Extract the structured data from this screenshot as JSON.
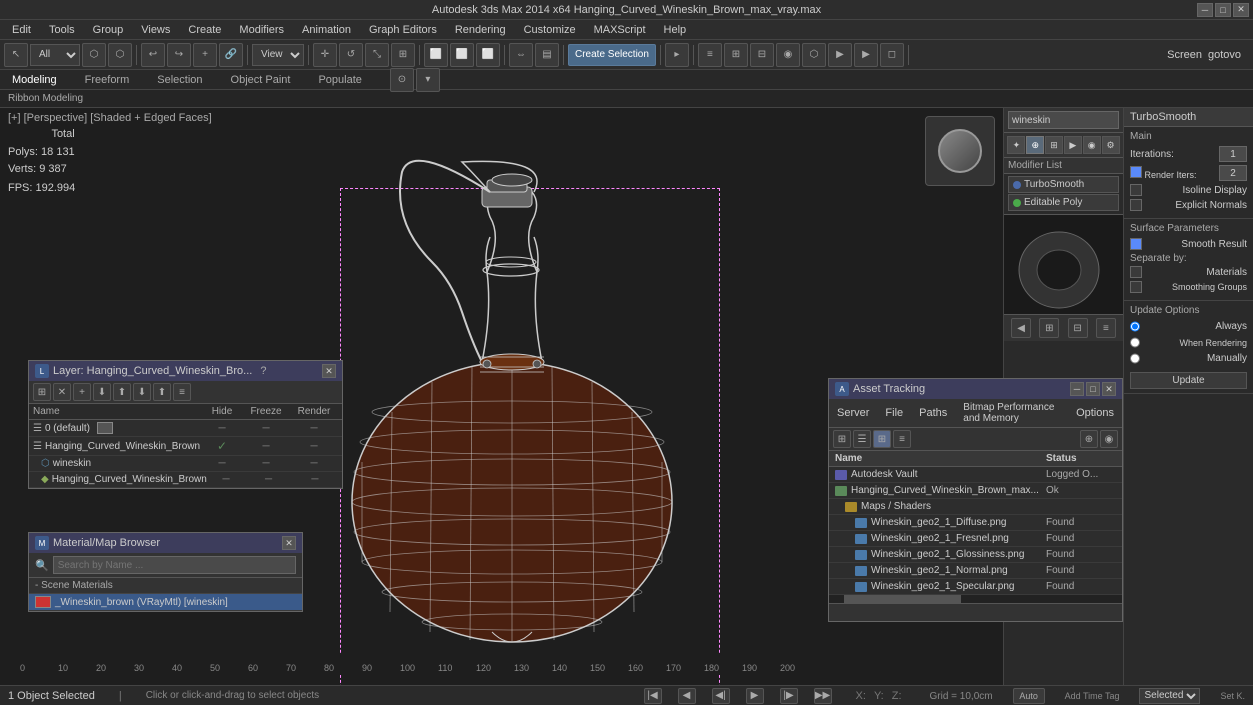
{
  "titleBar": {
    "title": "Autodesk 3ds Max 2014 x64    Hanging_Curved_Wineskin_Brown_max_vray.max",
    "minimize": "─",
    "maximize": "□",
    "close": "✕"
  },
  "menuBar": {
    "items": [
      "Edit",
      "Tools",
      "Group",
      "Views",
      "Create",
      "Modifiers",
      "Animation",
      "Graph Editors",
      "Rendering",
      "Customize",
      "MAXScript",
      "Help"
    ]
  },
  "toolbar": {
    "viewDropdown": "All",
    "viewTypeDropdown": "View",
    "createSelection": "Create Selection"
  },
  "modeBars": {
    "top": [
      "Modeling",
      "Freeform",
      "Selection",
      "Object Paint",
      "Populate"
    ],
    "bottom": "Ribbon Modeling"
  },
  "viewport": {
    "label": "[+] [Perspective] [Shaded + Edged Faces]",
    "stats": {
      "totalLabel": "Total",
      "polysLabel": "Polys:",
      "polysValue": "18 131",
      "vertsLabel": "Verts:",
      "vertsValue": "9 387",
      "fpsLabel": "FPS:",
      "fpsValue": "192.994"
    }
  },
  "rightPanel": {
    "objectName": "wineskin",
    "modifierListLabel": "Modifier List",
    "modifiers": [
      {
        "name": "TurboSmooth",
        "active": true
      },
      {
        "name": "Editable Poly",
        "active": true
      }
    ]
  },
  "turbosmooth": {
    "title": "TurboSmooth",
    "mainLabel": "Main",
    "iterations": {
      "label": "Iterations:",
      "value": "1"
    },
    "renderIters": {
      "label": "Render Iters:",
      "value": "2"
    },
    "isoline": {
      "label": "Isoline Display"
    },
    "explicitNormals": {
      "label": "Explicit Normals"
    },
    "surfaceParams": {
      "title": "Surface Parameters"
    },
    "smoothResult": {
      "label": "Smooth Result"
    },
    "separateBy": {
      "label": "Separate by:"
    },
    "materials": {
      "label": "Materials"
    },
    "smoothingGroups": {
      "label": "Smoothing Groups"
    },
    "updateOptions": {
      "title": "Update Options"
    },
    "always": {
      "label": "Always"
    },
    "whenRendering": {
      "label": "When Rendering"
    },
    "manually": {
      "label": "Manually"
    },
    "updateBtn": "Update"
  },
  "layerDialog": {
    "title": "Layer: Hanging_Curved_Wineskin_Bro...",
    "questionMark": "?",
    "columns": {
      "name": "Name",
      "hide": "Hide",
      "freeze": "Freeze",
      "render": "Render"
    },
    "layers": [
      {
        "indent": 0,
        "name": "0 (default)",
        "hide": "─",
        "freeze": "─",
        "render": "─",
        "isDefault": true
      },
      {
        "indent": 0,
        "name": "Hanging_Curved_Wineskin_Brown",
        "hide": "─",
        "freeze": "─",
        "render": "─",
        "hasCheck": true
      },
      {
        "indent": 1,
        "name": "wineskin",
        "hide": "─",
        "freeze": "─",
        "render": "─"
      },
      {
        "indent": 1,
        "name": "Hanging_Curved_Wineskin_Brown",
        "hide": "─",
        "freeze": "─",
        "render": "─"
      }
    ]
  },
  "materialBrowser": {
    "title": "Material/Map Browser",
    "searchPlaceholder": "Search by Name ...",
    "sceneMaterialsLabel": "- Scene Materials",
    "materials": [
      {
        "name": "_Wineskin_brown (VRayMtl) [wineskin]",
        "selected": true
      }
    ]
  },
  "assetTracking": {
    "title": "Asset Tracking",
    "windowControls": [
      "─",
      "□",
      "✕"
    ],
    "menu": [
      "Server",
      "File",
      "Paths",
      "Bitmap Performance and Memory",
      "Options"
    ],
    "columns": {
      "name": "Name",
      "status": "Status"
    },
    "rows": [
      {
        "indent": 0,
        "name": "Autodesk Vault",
        "status": "Logged O...",
        "iconType": "vault"
      },
      {
        "indent": 0,
        "name": "Hanging_Curved_Wineskin_Brown_max...",
        "status": "Ok",
        "iconType": "file"
      },
      {
        "indent": 1,
        "name": "Maps / Shaders",
        "status": "",
        "iconType": "folder"
      },
      {
        "indent": 2,
        "name": "Wineskin_geo2_1_Diffuse.png",
        "status": "Found",
        "iconType": "image"
      },
      {
        "indent": 2,
        "name": "Wineskin_geo2_1_Fresnel.png",
        "status": "Found",
        "iconType": "image"
      },
      {
        "indent": 2,
        "name": "Wineskin_geo2_1_Glossiness.png",
        "status": "Found",
        "iconType": "image"
      },
      {
        "indent": 2,
        "name": "Wineskin_geo2_1_Normal.png",
        "status": "Found",
        "iconType": "image"
      },
      {
        "indent": 2,
        "name": "Wineskin_geo2_1_Specular.png",
        "status": "Found",
        "iconType": "image"
      }
    ]
  },
  "statusBar": {
    "objectCount": "1 Object Selected",
    "hint": "Click or click-and-drag to select objects",
    "xLabel": "X:",
    "xValue": "",
    "yLabel": "Y:",
    "yValue": "",
    "zLabel": "Z:",
    "zValue": "",
    "gridLabel": "Grid = 10,0cm",
    "autoKeyLabel": "Auto",
    "selectionLabel": "Selected",
    "addTimeTagLabel": "Add Time Tag",
    "setKLabel": "Set K."
  },
  "timeline": {
    "ticks": [
      "0",
      "10",
      "20",
      "30",
      "40",
      "50",
      "60",
      "70",
      "80",
      "90",
      "100",
      "110",
      "120",
      "130",
      "140",
      "150",
      "160",
      "170",
      "180",
      "190",
      "200"
    ]
  }
}
